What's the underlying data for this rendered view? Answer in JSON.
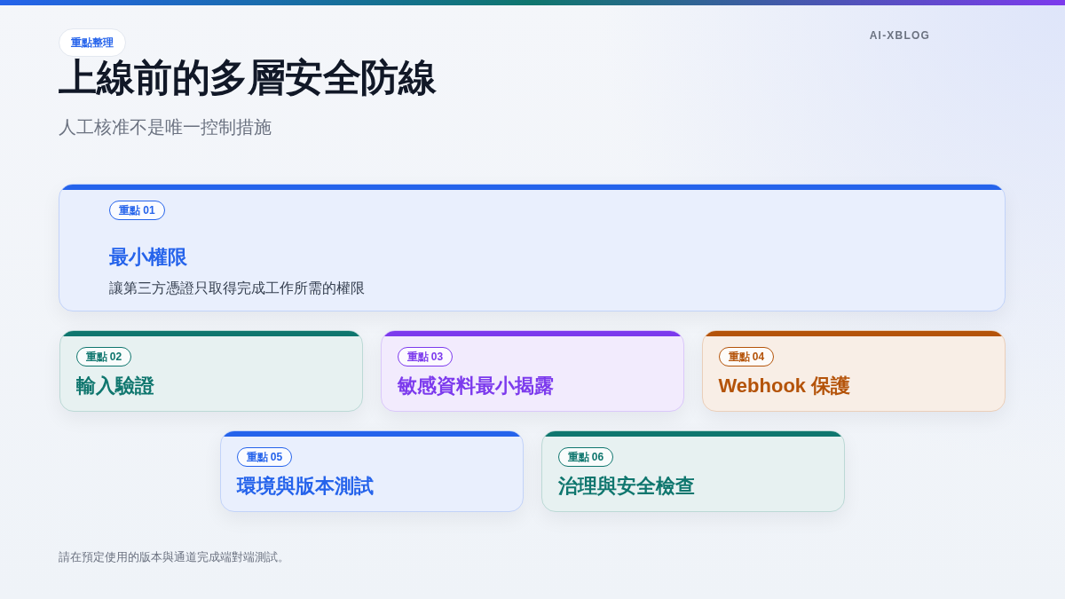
{
  "header": {
    "badge": "重點整理",
    "title": "上線前的多層安全防線",
    "subtitle": "人工核准不是唯一控制措施",
    "brand": "AI-XBLOG"
  },
  "cards": [
    {
      "kind": "feature",
      "badge": "重點 01",
      "title": "最小權限",
      "description": "讓第三方憑證只取得完成工作所需的權限",
      "color": "#2563eb"
    },
    {
      "kind": "compact",
      "badge": "重點 02",
      "title": "輸入驗證",
      "color": "#0f766e"
    },
    {
      "kind": "compact",
      "badge": "重點 03",
      "title": "敏感資料最小揭露",
      "color": "#7c3aed"
    },
    {
      "kind": "compact",
      "badge": "重點 04",
      "title": "Webhook 保護",
      "color": "#b45309"
    },
    {
      "kind": "compact",
      "badge": "重點 05",
      "title": "環境與版本測試",
      "color": "#2563eb"
    },
    {
      "kind": "compact",
      "badge": "重點 06",
      "title": "治理與安全檢查",
      "color": "#0f766e"
    }
  ],
  "footer": "請在預定使用的版本與通道完成端對端測試。"
}
